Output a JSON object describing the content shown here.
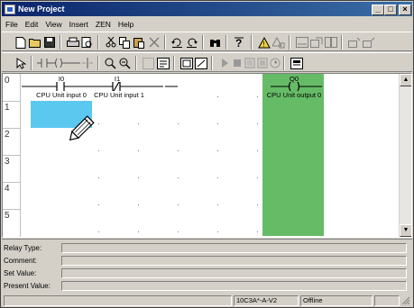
{
  "window": {
    "title": "New Project"
  },
  "menu": [
    "File",
    "Edit",
    "View",
    "Insert",
    "ZEN",
    "Help"
  ],
  "ladder": {
    "rows": [
      "0",
      "1",
      "2",
      "3",
      "4",
      "5"
    ],
    "contacts": [
      {
        "address": "I0",
        "comment": "CPU Unit input 0"
      },
      {
        "address": "I1",
        "comment": "CPU Unit input 1"
      }
    ],
    "output": {
      "address": "Q0",
      "comment": "CPU Unit output 0"
    }
  },
  "properties": {
    "relay_type": "Relay Type:",
    "comment": "Comment:",
    "set_value": "Set Value:",
    "present_value": "Present Value:"
  },
  "status": {
    "device": "10C3A*-A-V2",
    "mode": "Offline"
  },
  "colors": {
    "selected_cell": "#5bc8ef",
    "output_column": "#66bb66",
    "title_bar": "#0a246a"
  }
}
